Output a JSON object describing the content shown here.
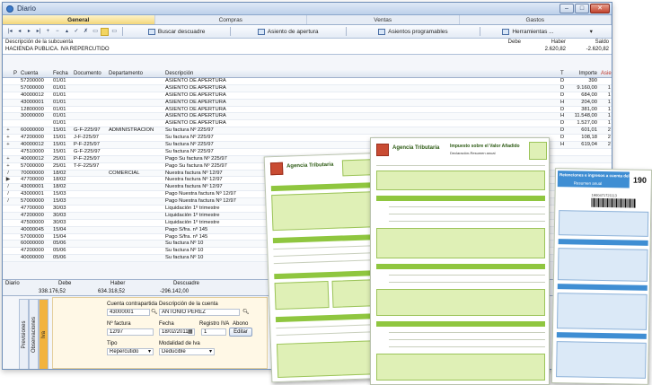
{
  "window": {
    "title": "Diario"
  },
  "tabs": [
    "General",
    "Compras",
    "Ventas",
    "Gastos"
  ],
  "toolbar": {
    "nav": [
      "|◂",
      "◂",
      "▸",
      "▸|",
      "+",
      "−",
      "▴",
      "✓",
      "✗"
    ],
    "buscar": "Buscar descuadre",
    "asiento_apertura": "Asiento de apertura",
    "asientos_programables": "Asientos programables",
    "herramientas": "Herramientas ..."
  },
  "descbar": {
    "desc_label": "Descripción de la subcuenta",
    "desc_value": "HACIENDA PUBLICA. IVA REPERCUTIDO",
    "debe_label": "Debe",
    "haber_label": "Haber",
    "haber_value": "2.620,82",
    "saldo_label": "Saldo",
    "saldo_value": "-2.620,82"
  },
  "grid": {
    "columns": {
      "p": "P",
      "cuenta": "Cuenta",
      "fecha": "Fecha",
      "documento": "Documento",
      "departamento": "Departamento",
      "descripcion": "Descripción",
      "t": "T",
      "importe": "Importe",
      "asiento": "Asiento"
    },
    "rows": [
      {
        "sel": "",
        "cuenta": "57200000",
        "fecha": "01/01",
        "doc": "",
        "dep": "",
        "desc": "ASIENTO DE APERTURA",
        "t": "D",
        "imp": "390",
        "as": ""
      },
      {
        "sel": "",
        "cuenta": "57000000",
        "fecha": "01/01",
        "doc": "",
        "dep": "",
        "desc": "ASIENTO DE APERTURA",
        "t": "D",
        "imp": "9.160,00",
        "as": "1"
      },
      {
        "sel": "",
        "cuenta": "40000012",
        "fecha": "01/01",
        "doc": "",
        "dep": "",
        "desc": "ASIENTO DE APERTURA",
        "t": "D",
        "imp": "684,00",
        "as": "1"
      },
      {
        "sel": "",
        "cuenta": "43000001",
        "fecha": "01/01",
        "doc": "",
        "dep": "",
        "desc": "ASIENTO DE APERTURA",
        "t": "H",
        "imp": "204,00",
        "as": "1"
      },
      {
        "sel": "",
        "cuenta": "12800000",
        "fecha": "01/01",
        "doc": "",
        "dep": "",
        "desc": "ASIENTO DE APERTURA",
        "t": "D",
        "imp": "381,00",
        "as": "1"
      },
      {
        "sel": "",
        "cuenta": "30000000",
        "fecha": "01/01",
        "doc": "",
        "dep": "",
        "desc": "ASIENTO DE APERTURA",
        "t": "H",
        "imp": "11.548,00",
        "as": "1"
      },
      {
        "sel": "",
        "cuenta": "",
        "fecha": "01/01",
        "doc": "",
        "dep": "",
        "desc": "ASIENTO DE APERTURA",
        "t": "D",
        "imp": "1.527,00",
        "as": "1"
      },
      {
        "sel": "+",
        "cuenta": "60000000",
        "fecha": "15/01",
        "doc": "G-F-225/97",
        "dep": "ADMINISTRACION",
        "desc": "Su factura Nº 225/97",
        "t": "D",
        "imp": "601,01",
        "as": "2"
      },
      {
        "sel": "+",
        "cuenta": "47200000",
        "fecha": "15/01",
        "doc": "J-F-225/97",
        "dep": "",
        "desc": "Su factura Nº 225/97",
        "t": "D",
        "imp": "108,18",
        "as": "2"
      },
      {
        "sel": "+",
        "cuenta": "40000012",
        "fecha": "15/01",
        "doc": "P-F-225/97",
        "dep": "",
        "desc": "Su factura Nº 225/97",
        "t": "H",
        "imp": "619,04",
        "as": "2"
      },
      {
        "sel": "",
        "cuenta": "47510000",
        "fecha": "15/01",
        "doc": "G-F-225/97",
        "dep": "",
        "desc": "Su factura Nº 225/97",
        "t": "",
        "imp": "",
        "as": ""
      },
      {
        "sel": "+",
        "cuenta": "40000012",
        "fecha": "25/01",
        "doc": "P-F-225/97",
        "dep": "",
        "desc": "Pago Su factura Nº 225/97",
        "t": "",
        "imp": "",
        "as": ""
      },
      {
        "sel": "+",
        "cuenta": "57000000",
        "fecha": "25/01",
        "doc": "T-F-225/97",
        "dep": "",
        "desc": "Pago Su factura Nº 225/97",
        "t": "",
        "imp": "",
        "as": ""
      },
      {
        "sel": "/",
        "cuenta": "70000000",
        "fecha": "18/02",
        "doc": "",
        "dep": "COMERCIAL",
        "desc": "Nuestra factura Nº 12/97",
        "t": "",
        "imp": "",
        "as": ""
      },
      {
        "sel": "▶",
        "cuenta": "47700000",
        "fecha": "18/02",
        "doc": "",
        "dep": "",
        "desc": "Nuestra factura Nº 12/97",
        "t": "",
        "imp": "",
        "as": ""
      },
      {
        "sel": "/",
        "cuenta": "43000001",
        "fecha": "18/02",
        "doc": "",
        "dep": "",
        "desc": "Nuestra factura Nº 12/97",
        "t": "",
        "imp": "",
        "as": ""
      },
      {
        "sel": "/",
        "cuenta": "43000001",
        "fecha": "15/03",
        "doc": "",
        "dep": "",
        "desc": "Pago Nuestra factura Nº 12/97",
        "t": "",
        "imp": "",
        "as": ""
      },
      {
        "sel": "/",
        "cuenta": "57000000",
        "fecha": "15/03",
        "doc": "",
        "dep": "",
        "desc": "Pago Nuestra factura Nº 12/97",
        "t": "",
        "imp": "",
        "as": ""
      },
      {
        "sel": "",
        "cuenta": "47700000",
        "fecha": "30/03",
        "doc": "",
        "dep": "",
        "desc": "Liquidación 1º trimestre",
        "t": "",
        "imp": "",
        "as": ""
      },
      {
        "sel": "",
        "cuenta": "47200000",
        "fecha": "30/03",
        "doc": "",
        "dep": "",
        "desc": "Liquidación 1º trimestre",
        "t": "",
        "imp": "",
        "as": ""
      },
      {
        "sel": "",
        "cuenta": "47500000",
        "fecha": "30/03",
        "doc": "",
        "dep": "",
        "desc": "Liquidación 1º trimestre",
        "t": "",
        "imp": "",
        "as": ""
      },
      {
        "sel": "",
        "cuenta": "40000045",
        "fecha": "15/04",
        "doc": "",
        "dep": "",
        "desc": "Pago S/fra. nº 145",
        "t": "",
        "imp": "",
        "as": ""
      },
      {
        "sel": "",
        "cuenta": "57000000",
        "fecha": "15/04",
        "doc": "",
        "dep": "",
        "desc": "Pago S/fra. nº 145",
        "t": "",
        "imp": "",
        "as": ""
      },
      {
        "sel": "",
        "cuenta": "60000000",
        "fecha": "05/06",
        "doc": "",
        "dep": "",
        "desc": "Su factura Nº 10",
        "t": "",
        "imp": "",
        "as": ""
      },
      {
        "sel": "",
        "cuenta": "47200000",
        "fecha": "05/06",
        "doc": "",
        "dep": "",
        "desc": "Su factura Nº 10",
        "t": "",
        "imp": "",
        "as": ""
      },
      {
        "sel": "",
        "cuenta": "40000000",
        "fecha": "05/06",
        "doc": "",
        "dep": "",
        "desc": "Su factura Nº 10",
        "t": "",
        "imp": "",
        "as": ""
      }
    ]
  },
  "totals": {
    "diario_label": "Diario",
    "debe_label": "Debe",
    "debe_diario": "338.176,52",
    "haber_label": "Haber",
    "haber_diario": "634.318,52",
    "descuadre_label": "Descuadre",
    "descuadre_value": "-296.142,00"
  },
  "sidetabs": [
    "Previsiones",
    "Observaciones",
    "Iva"
  ],
  "form": {
    "cta_label": "Cuenta contrapartida",
    "cta_value": "43000001",
    "cta_desc_label": "Descripción de la cuenta",
    "cta_desc_value": "ANTONIO PEREZ",
    "factura_label": "Nº factura",
    "factura_value": "12/97",
    "fecha_label": "Fecha",
    "fecha_value": "18/02/2011",
    "registro_label": "Registro IVA",
    "registro_value": "1",
    "abono_label": "Abono",
    "editar": "Editar",
    "tipo_label": "Tipo",
    "tipo_value": "Repercutido",
    "modalidad_label": "Modalidad de Iva",
    "modalidad_value": "Deducible"
  },
  "overlay": {
    "agency": "Agencia Tributaria",
    "form2_title": "Impuesto sobre el Valor Añadido",
    "form2_sub": "Declaración-Resumen anual",
    "form3_title": "Retenciones e ingresos a cuenta del IRPF",
    "form3_sub": "Resumen anual",
    "model_number": "190",
    "barcode_num": "1900471721113",
    "colors": {
      "green": "#8fc63f",
      "blue": "#3f8ed3"
    }
  }
}
